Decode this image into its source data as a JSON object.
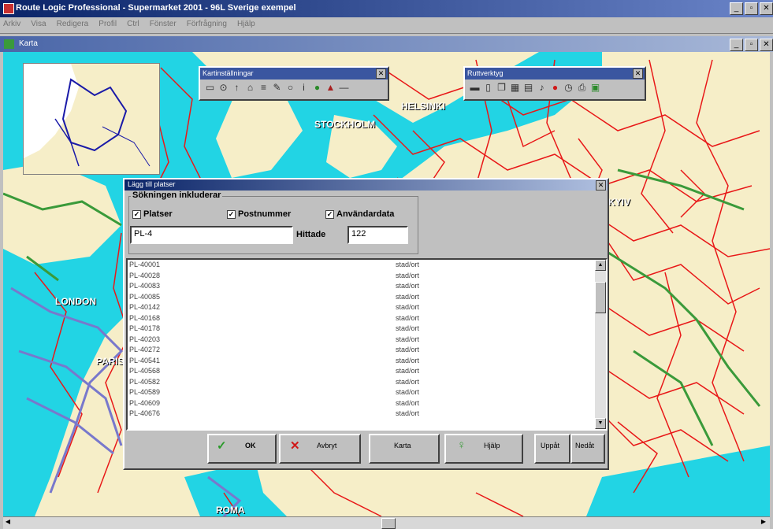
{
  "app": {
    "title": "Route Logic Professional - Supermarket 2001 - 96L Sverige exempel"
  },
  "menu": {
    "items": [
      "Arkiv",
      "Visa",
      "Redigera",
      "Profil",
      "Ctrl",
      "Fönster",
      "Förfrågning",
      "Hjälp"
    ]
  },
  "child_window": {
    "title": "Karta"
  },
  "map": {
    "city_labels": {
      "helsinki": "HELSINKI",
      "stockholm": "STOCKHOLM",
      "london": "LONDON",
      "paris": "PARIS",
      "roma": "ROMA",
      "kyiv": "KYIV"
    },
    "colors": {
      "sea": "#22d4e4",
      "land": "#f6eec8",
      "roads": "#e81818",
      "highways": "#7878cc",
      "green_routes": "#3a9a3a"
    }
  },
  "toolbar1": {
    "title": "Kartinställningar",
    "close": "✕",
    "icons": [
      "window-icon",
      "zoom-icon",
      "pointer-icon",
      "home-icon",
      "road-icon",
      "pen-icon",
      "circle-icon",
      "info-icon",
      "globe-icon",
      "building-icon",
      "line-icon"
    ]
  },
  "toolbar2": {
    "title": "Ruttverktyg",
    "close": "✕",
    "icons": [
      "truck-icon",
      "document-icon",
      "copy-icon",
      "grid-icon",
      "panel-icon",
      "list-icon",
      "stop-icon",
      "clock-icon",
      "printer-icon",
      "map-icon"
    ]
  },
  "dialog": {
    "title": "Lägg till platser",
    "close": "✕",
    "group_label": "Sökningen inkluderar",
    "check_places": "Platser",
    "check_postal": "Postnummer",
    "check_user": "Användardata",
    "search_value": "PL-4",
    "found_label": "Hittade",
    "found_value": "122",
    "rows": [
      {
        "id": "PL-40001",
        "type": "stad/ort"
      },
      {
        "id": "PL-40028",
        "type": "stad/ort"
      },
      {
        "id": "PL-40083",
        "type": "stad/ort"
      },
      {
        "id": "PL-40085",
        "type": "stad/ort"
      },
      {
        "id": "PL-40142",
        "type": "stad/ort"
      },
      {
        "id": "PL-40168",
        "type": "stad/ort"
      },
      {
        "id": "PL-40178",
        "type": "stad/ort"
      },
      {
        "id": "PL-40203",
        "type": "stad/ort"
      },
      {
        "id": "PL-40272",
        "type": "stad/ort"
      },
      {
        "id": "PL-40541",
        "type": "stad/ort"
      },
      {
        "id": "PL-40568",
        "type": "stad/ort"
      },
      {
        "id": "PL-40582",
        "type": "stad/ort"
      },
      {
        "id": "PL-40589",
        "type": "stad/ort"
      },
      {
        "id": "PL-40609",
        "type": "stad/ort"
      },
      {
        "id": "PL-40676",
        "type": "stad/ort"
      }
    ],
    "buttons": {
      "ok": "OK",
      "cancel": "Avbryt",
      "map": "Karta",
      "help": "Hjälp",
      "up": "Uppåt",
      "down": "Nedåt"
    }
  }
}
